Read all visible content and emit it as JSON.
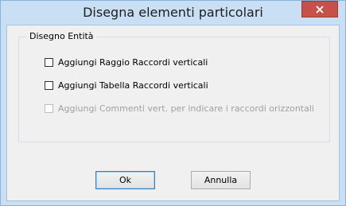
{
  "window": {
    "title": "Disegna elementi particolari"
  },
  "group": {
    "legend": "Disegno Entità",
    "options": [
      {
        "label": "Aggiungi Raggio Raccordi verticali",
        "checked": false,
        "enabled": true
      },
      {
        "label": "Aggiungi Tabella Raccordi verticali",
        "checked": false,
        "enabled": true
      },
      {
        "label": "Aggiungi Commenti vert. per indicare i raccordi orizzontali",
        "checked": false,
        "enabled": false
      }
    ]
  },
  "buttons": {
    "ok_label": "Ok",
    "cancel_label": "Annulla"
  },
  "icons": {
    "close": "close-icon"
  },
  "colors": {
    "close_button": "#c7504a",
    "titlebar": "#c9dff3",
    "client_bg": "#f0f0f0"
  }
}
